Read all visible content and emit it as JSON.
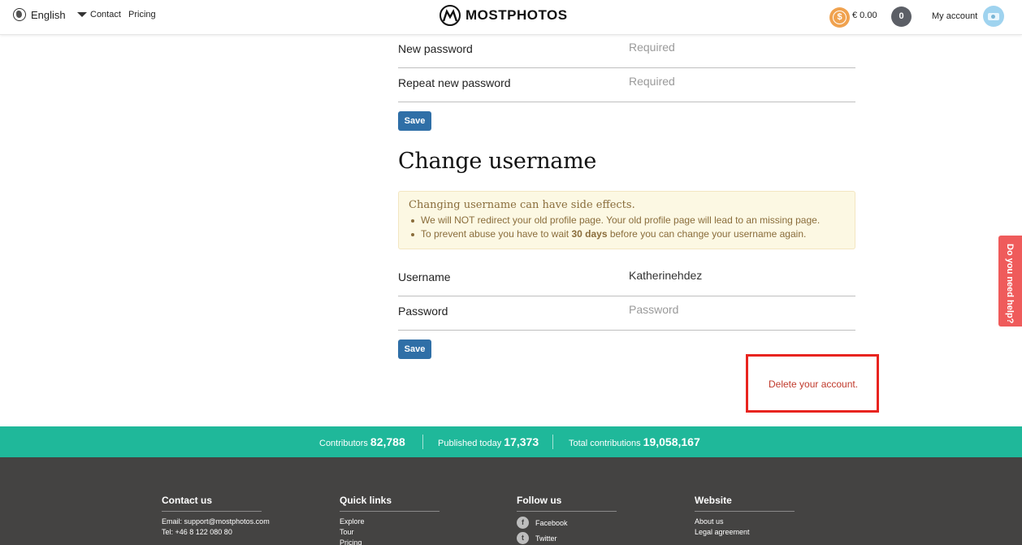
{
  "header": {
    "language": "English",
    "nav": [
      "Contact",
      "Pricing"
    ],
    "logo_text": "MOSTPHOTOS",
    "coin_symbol": "$",
    "balance": "€ 0.00",
    "cart_count": "0",
    "my_account": "My account"
  },
  "password_form": {
    "new_password_label": "New password",
    "new_password_placeholder": "Required",
    "repeat_password_label": "Repeat new password",
    "repeat_password_placeholder": "Required",
    "save_label": "Save"
  },
  "username_section": {
    "title": "Change username",
    "warning_title": "Changing username can have side effects.",
    "warning_item_1": "We will NOT redirect your old profile page. Your old profile page will lead to an missing page.",
    "warning_item_2_pre": "To prevent abuse you have to wait ",
    "warning_item_2_bold": "30 days",
    "warning_item_2_post": " before you can change your username again.",
    "username_label": "Username",
    "username_value": "Katherinehdez",
    "password_label": "Password",
    "password_placeholder": "Password",
    "save_label": "Save"
  },
  "delete_account": "Delete your account.",
  "help_tab": "Do you need help?",
  "stats": {
    "contributors_label": "Contributors",
    "contributors_value": "82,788",
    "published_label": "Published today",
    "published_value": "17,373",
    "total_label": "Total contributions",
    "total_value": "19,058,167"
  },
  "footer": {
    "contact": {
      "heading": "Contact us",
      "email": "Email: support@mostphotos.com",
      "tel": "Tel: +46 8 122 080 80"
    },
    "quick_links": {
      "heading": "Quick links",
      "items": [
        "Explore",
        "Tour",
        "Pricing"
      ]
    },
    "follow": {
      "heading": "Follow us",
      "items": [
        "Facebook",
        "Twitter"
      ]
    },
    "website": {
      "heading": "Website",
      "items": [
        "About us",
        "Legal agreement"
      ]
    }
  },
  "colors": {
    "accent_teal": "#1fb89a",
    "button_blue": "#2f6fa7",
    "help_red": "#ef5b5b",
    "highlight_red": "#e8241f",
    "coin_orange": "#f0a24f",
    "footer_dark": "#444342"
  }
}
